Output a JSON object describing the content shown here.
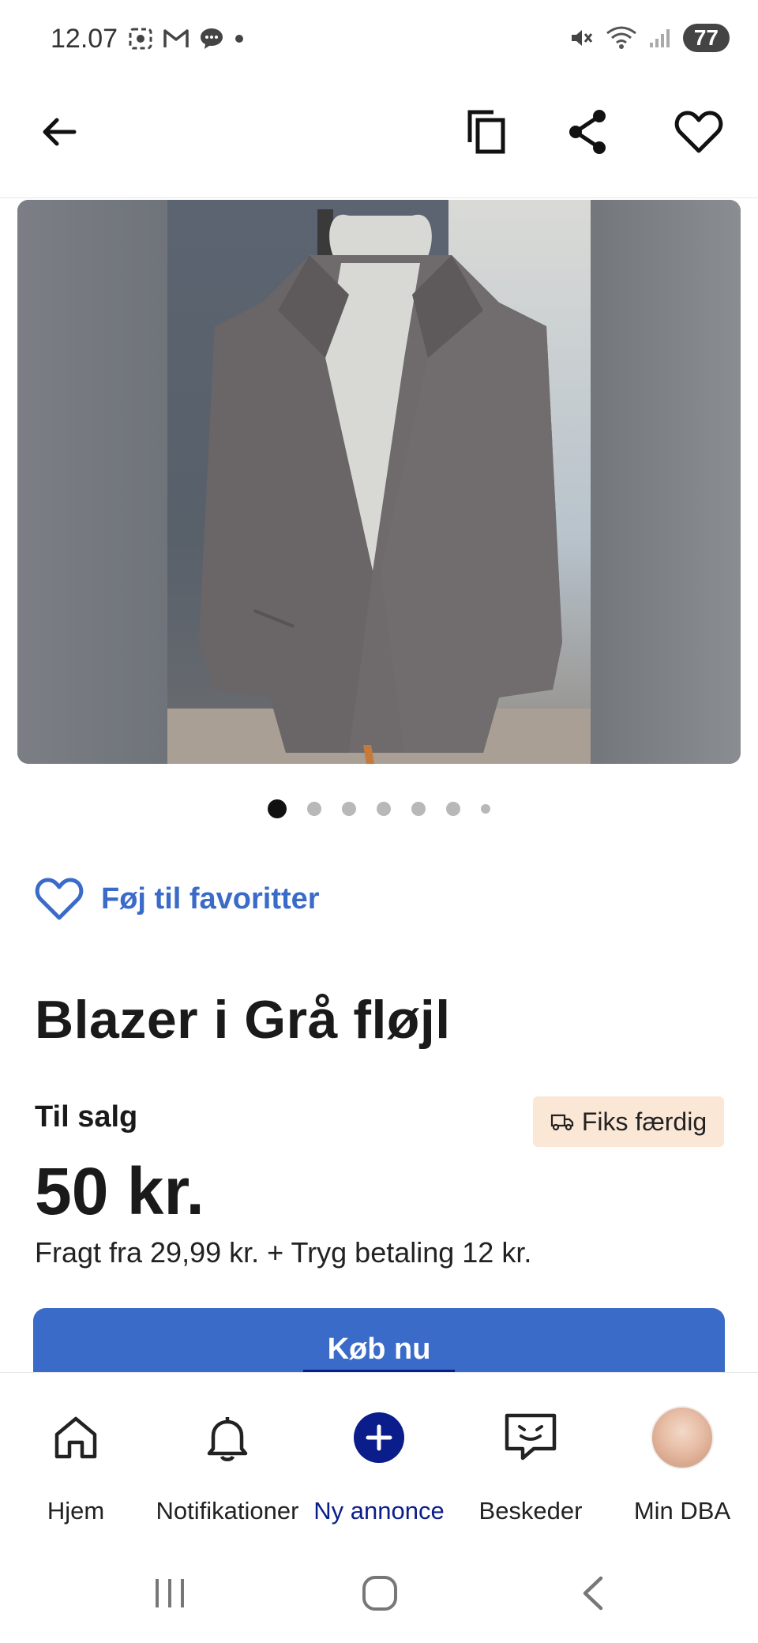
{
  "status_bar": {
    "time": "12.07",
    "battery": "77"
  },
  "app_bar": {
    "back_icon": "arrow-left-icon",
    "copy_icon": "copy-icon",
    "share_icon": "share-icon",
    "favorite_icon": "heart-outline-icon"
  },
  "gallery": {
    "image_count": 7,
    "active_index": 0
  },
  "favorite": {
    "label": "Føj til favoritter"
  },
  "listing": {
    "title": "Blazer i Grå fløjl",
    "sale_type": "Til salg",
    "badge": "Fiks færdig",
    "price": "50 kr.",
    "shipping": "Fragt fra 29,99 kr. + Tryg betaling 12 kr."
  },
  "buy_button": {
    "label": "Køb nu"
  },
  "bottom_nav": {
    "items": [
      {
        "label": "Hjem",
        "icon": "home-icon"
      },
      {
        "label": "Notifikationer",
        "icon": "bell-icon"
      },
      {
        "label": "Ny annonce",
        "icon": "plus-circle-icon",
        "active": true
      },
      {
        "label": "Beskeder",
        "icon": "chat-icon"
      },
      {
        "label": "Min DBA",
        "icon": "avatar-icon"
      }
    ]
  },
  "colors": {
    "accent": "#3a6bc8",
    "nav_active": "#0b1d8a",
    "badge_bg": "#fbe7d6"
  }
}
